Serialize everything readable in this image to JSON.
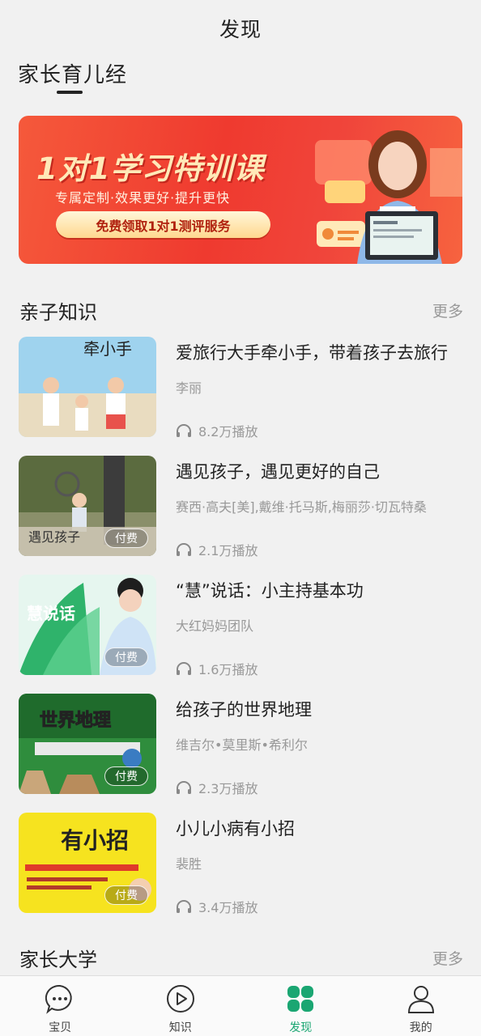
{
  "header": {
    "title": "发现"
  },
  "tabs": {
    "active_label": "家长育儿经"
  },
  "banner": {
    "title": "1对1学习特训课",
    "subtitle": "专属定制·效果更好·提升更快",
    "cta": "免费领取1对1测评服务"
  },
  "sections": [
    {
      "title": "亲子知识",
      "more": "更多"
    },
    {
      "title": "家长大学",
      "more": "更多"
    }
  ],
  "items": [
    {
      "title": "爱旅行大手牵小手，带着孩子去旅行",
      "author": "李丽",
      "plays": "8.2万播放",
      "paid": false,
      "cover_text": "牵小手"
    },
    {
      "title": "遇见孩子，遇见更好的自己",
      "author": "赛西·高夫[美],戴维·托马斯,梅丽莎·切瓦特桑",
      "plays": "2.1万播放",
      "paid": true,
      "paid_label": "付费",
      "cover_text": "遇见孩子"
    },
    {
      "title": "“慧”说话：小主持基本功",
      "author": "大红妈妈团队",
      "plays": "1.6万播放",
      "paid": true,
      "paid_label": "付费",
      "cover_text": "慧说话"
    },
    {
      "title": "给孩子的世界地理",
      "author": "维吉尔•莫里斯•希利尔",
      "plays": "2.3万播放",
      "paid": true,
      "paid_label": "付费",
      "cover_text": "世界地理"
    },
    {
      "title": "小儿小病有小招",
      "author": "裴胜",
      "plays": "3.4万播放",
      "paid": true,
      "paid_label": "付费",
      "cover_text": "有小招"
    }
  ],
  "nav": [
    {
      "label": "宝贝",
      "icon": "chat-bubble-icon"
    },
    {
      "label": "知识",
      "icon": "play-circle-icon"
    },
    {
      "label": "发现",
      "icon": "four-petal-icon",
      "active": true
    },
    {
      "label": "我的",
      "icon": "person-icon"
    }
  ],
  "colors": {
    "accent": "#1aa672",
    "banner_red": "#ef3a2f",
    "muted": "#999999"
  }
}
